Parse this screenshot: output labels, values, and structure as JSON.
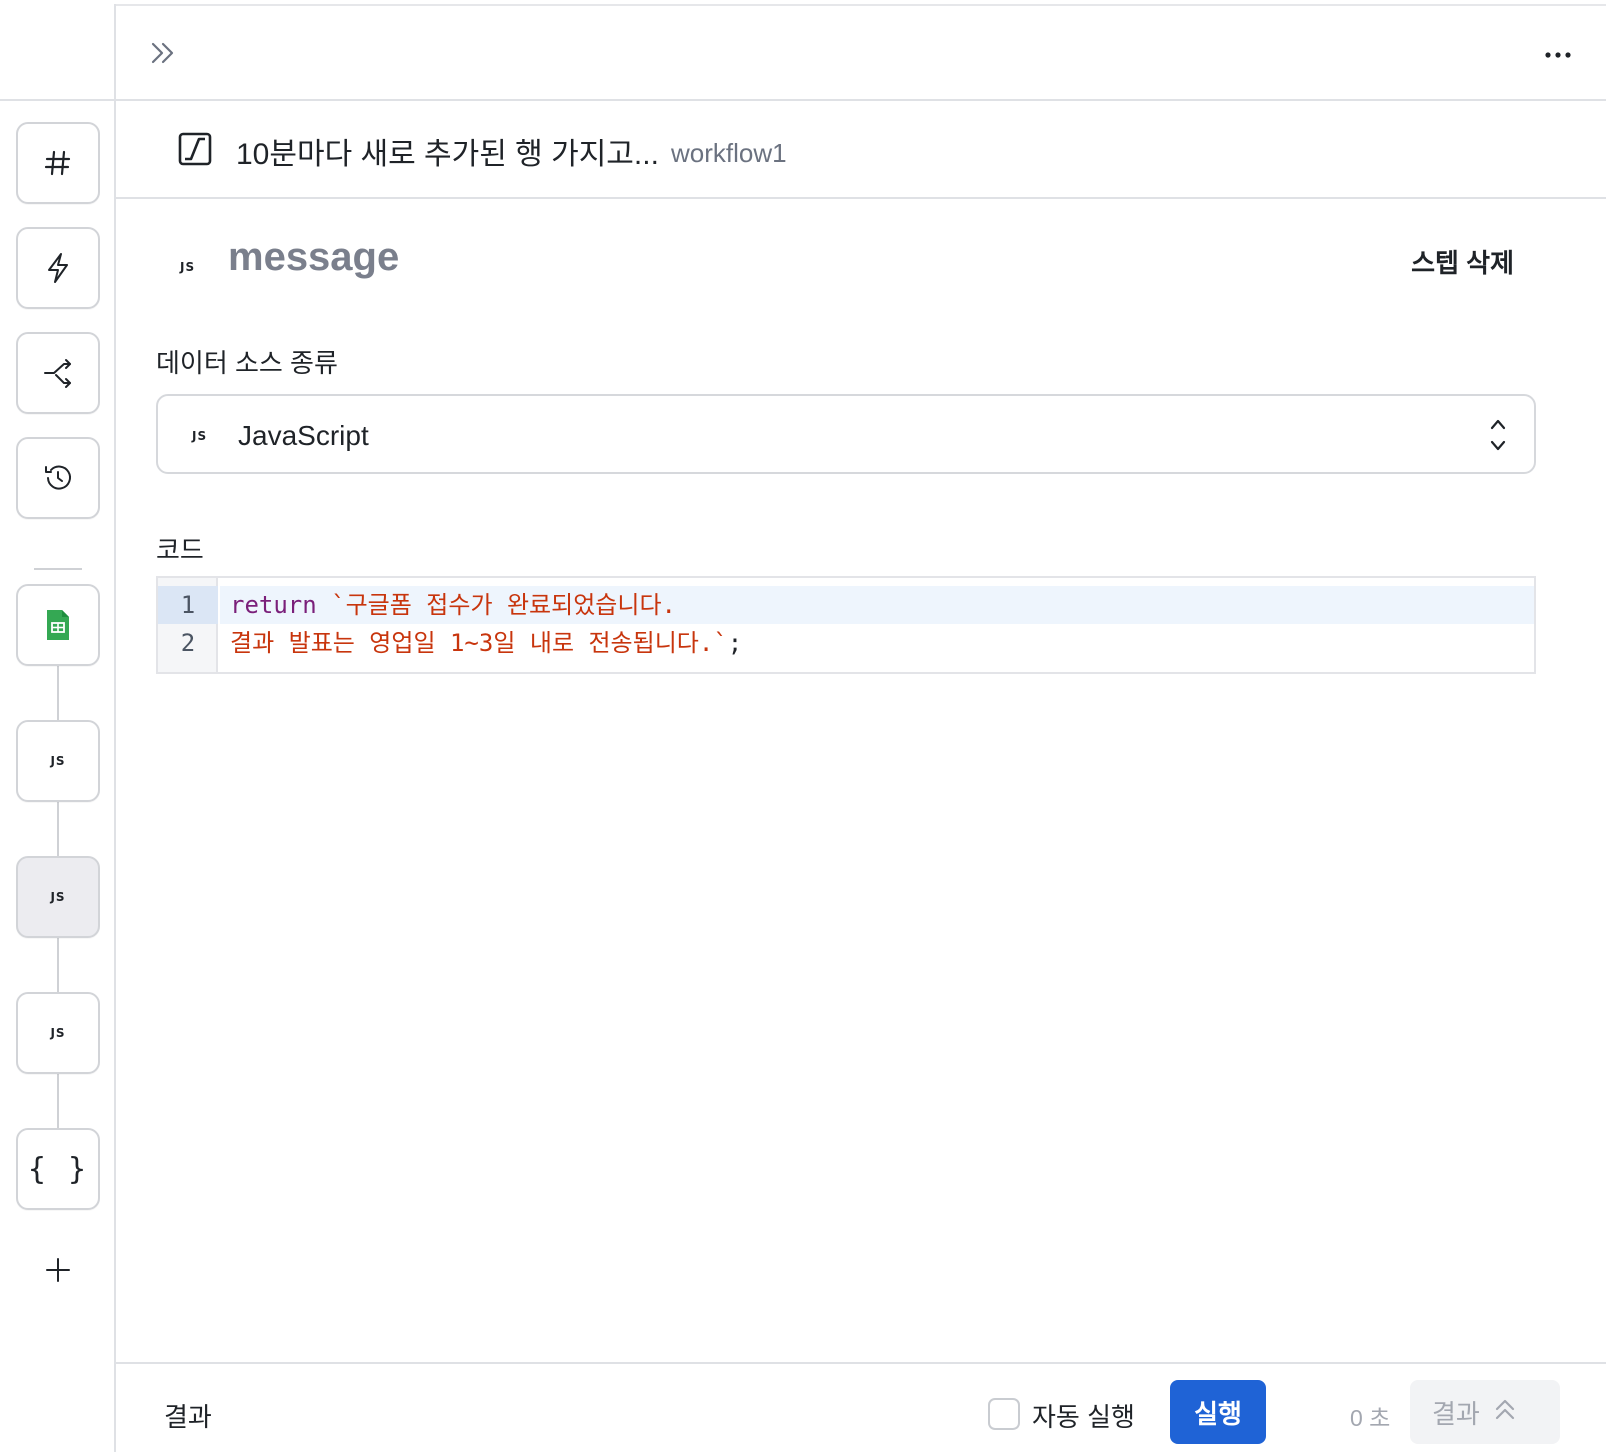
{
  "rail": {
    "tools": [
      {
        "name": "hash",
        "icon": "hash-icon"
      },
      {
        "name": "trigger",
        "icon": "lightning-icon"
      },
      {
        "name": "branch",
        "icon": "branch-arrow-icon"
      },
      {
        "name": "history",
        "icon": "history-icon"
      }
    ],
    "steps": [
      {
        "icon": "google-sheets-icon",
        "label": ""
      },
      {
        "icon": "js-icon",
        "label": "JS"
      },
      {
        "icon": "js-icon",
        "label": "JS",
        "selected": true
      },
      {
        "icon": "js-icon",
        "label": "JS"
      },
      {
        "icon": "braces-icon",
        "label": "{ }"
      }
    ],
    "add_icon": "plus-icon"
  },
  "topbar": {
    "expand_icon": "double-chevron-right-icon",
    "more_icon": "more-horizontal-icon"
  },
  "workflow": {
    "icon": "workflow-icon",
    "title": "10분마다 새로 추가된 행 가지고...",
    "name": "workflow1"
  },
  "step": {
    "type_badge": "JS",
    "name": "message",
    "delete_label": "스텝 삭제"
  },
  "data_source": {
    "label": "데이터 소스 종류",
    "badge": "JS",
    "value": "JavaScript",
    "chevron_icon": "chevron-up-down-icon"
  },
  "code": {
    "label": "코드",
    "line_numbers": [
      "1",
      "2"
    ],
    "line1_keyword": "return",
    "line1_string": " `구글폼 접수가 완료되었습니다.",
    "line2_string": "결과 발표는 영업일 1~3일 내로 전송됩니다.`",
    "line2_punct": ";"
  },
  "footer": {
    "label": "결과",
    "auto_run_label": "자동 실행",
    "auto_run_checked": false,
    "run_label": "실행",
    "elapsed": "0 초",
    "result_label": "결과",
    "result_icon": "chevron-double-up-icon"
  },
  "colors": {
    "run_button": "#1f63d6",
    "keyword": "#7a1f7a",
    "string": "#c8350d",
    "sheets_green": "#34a853"
  }
}
